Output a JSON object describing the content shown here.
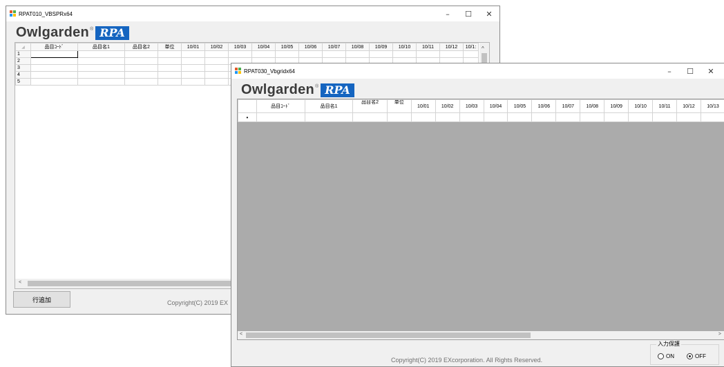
{
  "window1": {
    "title": "RPAT010_VBSPRx64",
    "logo": {
      "text": "Owlgarden",
      "reg": "®",
      "badge": "RPA"
    },
    "grid": {
      "columns": [
        "品目ｺｰﾄﾞ",
        "品目名1",
        "品目名2",
        "単位",
        "10/01",
        "10/02",
        "10/03",
        "10/04",
        "10/05",
        "10/06",
        "10/07",
        "10/08",
        "10/09",
        "10/10",
        "10/11",
        "10/12",
        "10/1:"
      ],
      "rows": [
        "1",
        "2",
        "3",
        "4",
        "5"
      ]
    },
    "add_row_button": "行追加",
    "copyright": "Copyright(C) 2019 EX",
    "scroll_left": "<"
  },
  "window2": {
    "title": "RPAT030_Vbgridx64",
    "logo": {
      "text": "Owlgarden",
      "reg": "®",
      "badge": "RPA"
    },
    "grid": {
      "columns": [
        "品目ｺｰﾄﾞ",
        "品目名1",
        "品目名2",
        "単位",
        "10/01",
        "10/02",
        "10/03",
        "10/04",
        "10/05",
        "10/06",
        "10/07",
        "10/08",
        "10/09",
        "10/10",
        "10/11",
        "10/12",
        "10/13"
      ],
      "new_row_marker": "•"
    },
    "copyright": "Copyright(C) 2019 EXcorporation. All Rights Reserved.",
    "input_guard": {
      "label": "入力保護",
      "options": [
        "ON",
        "OFF"
      ],
      "selected": "OFF"
    },
    "scroll_left": "<",
    "scroll_right": ">"
  },
  "window_buttons": {
    "minimize": "–",
    "maximize": "☐",
    "close": "✕"
  },
  "colors": {
    "rpa_blue": "#1565c0",
    "empty_grid_area": "#ababab"
  }
}
